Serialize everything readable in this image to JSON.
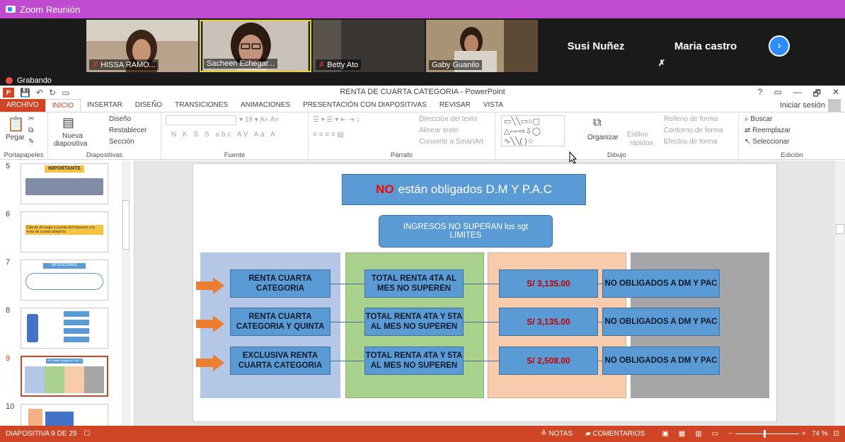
{
  "zoom": {
    "window_title": "Zoom Reunión",
    "participants": [
      {
        "name": "HISSA RAMO..."
      },
      {
        "name": "Sacheen Echegar..."
      },
      {
        "name": "Betty Ato"
      },
      {
        "name": "Gaby Guanilo"
      },
      {
        "name": "Susi Nuñez"
      },
      {
        "name": "Maria castro"
      }
    ],
    "recording_label": "Grabando",
    "next_icon": "chevron-right-icon"
  },
  "ppt": {
    "title": "RENTA DE CUARTA CATEGORIA - PowerPoint",
    "window_controls": [
      "?",
      "▭",
      "—",
      "🗗",
      "✕"
    ],
    "signin": "Iniciar sesión",
    "tabs": [
      "ARCHIVO",
      "INICIO",
      "INSERTAR",
      "DISEÑO",
      "TRANSICIONES",
      "ANIMACIONES",
      "PRESENTACIÓN CON DIAPOSITIVAS",
      "REVISAR",
      "VISTA"
    ],
    "active_tab": "INICIO",
    "ribbon": {
      "groups": [
        "Portapapeles",
        "Diapositivas",
        "Fuente",
        "Párrafo",
        "Dibujo",
        "Edición"
      ],
      "pegar": "Pegar",
      "nueva": "Nueva",
      "diapositiva": "diapositiva",
      "diseno": "Diseño",
      "restablecer": "Restablecer",
      "seccion": "Sección",
      "font_size": "18",
      "direccion_texto": "Dirección del texto",
      "alinear_texto": "Alinear texto",
      "convertir_smartart": "Convertir a SmartArt",
      "organizar": "Organizar",
      "estilos": "Estilos",
      "rapidos": "rápidos",
      "relleno": "Relleno de forma",
      "contorno": "Contorno de forma",
      "efectos": "Efectos de forma",
      "buscar": "Buscar",
      "reemplazar": "Reemplazar",
      "seleccionar": "Seleccionar"
    },
    "thumbnails": [
      {
        "num": "5",
        "label": "IMPORTANTE"
      },
      {
        "num": "6",
        "label": "Cálculo del pago a cuenta del impuesto a la renta de cuarta categoría"
      },
      {
        "num": "7",
        "label": "RETENCIONES"
      },
      {
        "num": "8",
        "label": ""
      },
      {
        "num": "9",
        "label": "NO están obligados D.M Y P.A.C"
      },
      {
        "num": "10",
        "label": ""
      }
    ],
    "slide": {
      "title_no": "NO",
      "title_rest": "están obligados  D.M  Y P.A.C",
      "subtitle_line1": "INGRESOS NO SUPERAN los sgt",
      "subtitle_line2": "LIMITES",
      "rows": [
        {
          "c1": "RENTA CUARTA CATEGORIA",
          "c2": "TOTAL RENTA 4TA AL MES NO SUPEREN",
          "c3": "S/ 3,135.00",
          "c4": "NO OBLIGADOS A DM Y PAC"
        },
        {
          "c1": "RENTA CUARTA CATEGORIA Y QUINTA",
          "c2": "TOTAL RENTA 4TA Y 5TA AL MES  NO SUPEREN",
          "c3": "S/ 3,135.00",
          "c4": "NO OBLIGADOS A DM Y PAC"
        },
        {
          "c1": "EXCLUSIVA RENTA CUARTA CATEGORIA",
          "c2": "TOTAL RENTA 4TA Y 5TA AL MES  NO SUPEREN",
          "c3": "S/ 2,508.00",
          "c4": "NO OBLIGADOS A DM Y PAC"
        }
      ],
      "colors": {
        "col1": "#b4c7e7",
        "col2": "#a9d18e",
        "col3": "#f8cbad",
        "col4": "#a6a6a6",
        "box": "#5b9bd5",
        "arrow": "#ed7d31"
      }
    },
    "status": {
      "slide_counter": "DIAPOSITIVA 9 DE 29",
      "notas": "NOTAS",
      "comentarios": "COMENTARIOS",
      "zoom": "74 %"
    }
  }
}
